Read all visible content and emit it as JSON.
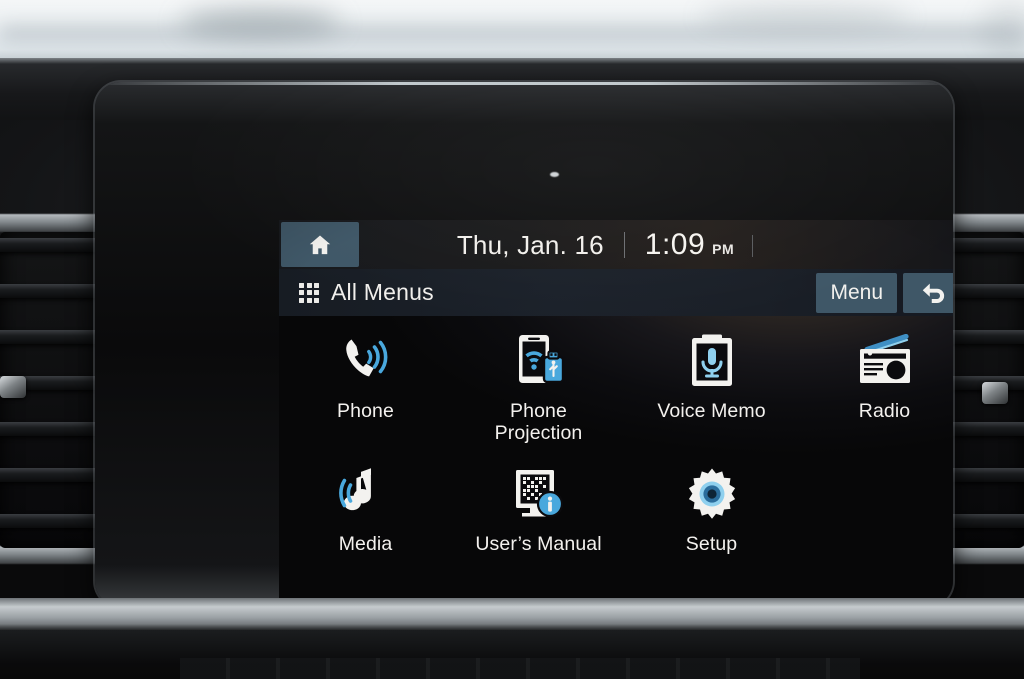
{
  "statusbar": {
    "home_icon": "home-icon",
    "date": "Thu, Jan. 16",
    "time": "1:09",
    "ampm": "PM"
  },
  "titlebar": {
    "grid_icon": "grid-icon",
    "title": "All Menus",
    "menu_label": "Menu",
    "back_icon": "back-arrow-icon"
  },
  "apps": [
    {
      "id": "phone",
      "label": "Phone",
      "icon": "phone-handset-icon"
    },
    {
      "id": "phone-projection",
      "label": "Phone\nProjection",
      "label_line1": "Phone",
      "label_line2": "Projection",
      "icon": "phone-projection-icon"
    },
    {
      "id": "voice-memo",
      "label": "Voice Memo",
      "icon": "voice-memo-icon"
    },
    {
      "id": "radio",
      "label": "Radio",
      "icon": "radio-icon"
    },
    {
      "id": "media",
      "label": "Media",
      "icon": "media-note-icon"
    },
    {
      "id": "users-manual",
      "label": "User’s Manual",
      "icon": "users-manual-qr-icon"
    },
    {
      "id": "setup",
      "label": "Setup",
      "icon": "gear-icon"
    }
  ],
  "colors": {
    "accent_blue": "#49a8dd",
    "button_slate": "#3f5767",
    "icon_white": "#f2f1ee",
    "titlebar_navy": "#1b212a",
    "screen_black": "#0c0c0f"
  }
}
